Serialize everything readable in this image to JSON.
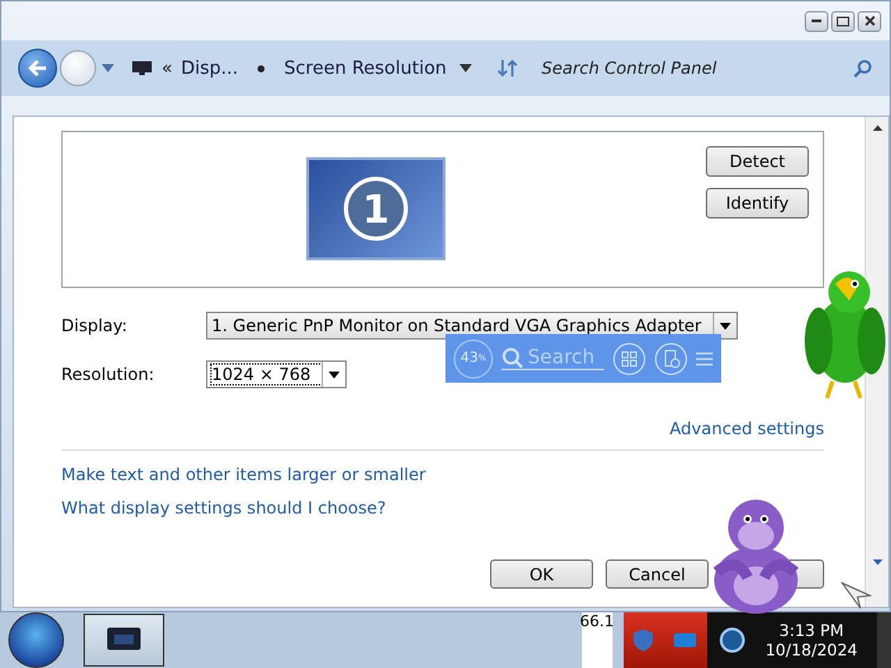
{
  "breadcrumb": {
    "chevron": "«",
    "parent": "Disp...",
    "current": "Screen Resolution"
  },
  "search": {
    "placeholder": "Search Control Panel"
  },
  "detect_button": "Detect",
  "identify_button": "Identify",
  "monitor_number": "1",
  "fields": [
    {
      "label": "Display:",
      "value": "1. Generic PnP Monitor on Standard VGA Graphics Adapter"
    },
    {
      "label": "Resolution:",
      "value": "1024 × 768"
    }
  ],
  "advanced_link": "Advanced settings",
  "links": [
    "Make text and other items larger or smaller",
    "What display settings should I choose?"
  ],
  "buttons": [
    "OK",
    "Cancel"
  ],
  "widget": {
    "percent": "43",
    "unit": "%",
    "placeholder": "Search"
  },
  "tray": {
    "meter": "66.1",
    "time": "3:13 PM",
    "date": "10/18/2024"
  }
}
